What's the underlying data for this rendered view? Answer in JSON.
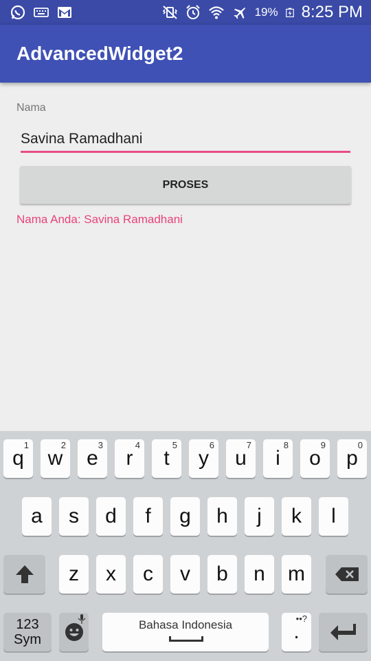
{
  "status_bar": {
    "icons_left": [
      "whatsapp-icon",
      "keyboard-icon",
      "gmail-icon"
    ],
    "icons_right": [
      "vibrate-icon",
      "alarm-icon",
      "wifi-icon",
      "airplane-icon",
      "battery-icon"
    ],
    "battery_percent": "19%",
    "clock": "8:25 PM"
  },
  "app_bar": {
    "title": "AdvancedWidget2"
  },
  "form": {
    "label": "Nama",
    "input_value": "Savina Ramadhani",
    "button_label": "PROSES",
    "result_text": "Nama Anda: Savina Ramadhani"
  },
  "keyboard": {
    "row1": [
      {
        "key": "q",
        "hint": "1"
      },
      {
        "key": "w",
        "hint": "2"
      },
      {
        "key": "e",
        "hint": "3"
      },
      {
        "key": "r",
        "hint": "4"
      },
      {
        "key": "t",
        "hint": "5"
      },
      {
        "key": "y",
        "hint": "6"
      },
      {
        "key": "u",
        "hint": "7"
      },
      {
        "key": "i",
        "hint": "8"
      },
      {
        "key": "o",
        "hint": "9"
      },
      {
        "key": "p",
        "hint": "0"
      }
    ],
    "row2": [
      "a",
      "s",
      "d",
      "f",
      "g",
      "h",
      "j",
      "k",
      "l"
    ],
    "row3": [
      "z",
      "x",
      "c",
      "v",
      "b",
      "n",
      "m"
    ],
    "sym_line1": "123",
    "sym_line2": "Sym",
    "space_label": "Bahasa Indonesia",
    "period_key": ".",
    "period_hint": "••?",
    "colors": {
      "accent": "#e84b86",
      "primary": "#3f51b5",
      "primary_dark": "#3a4aa6"
    }
  }
}
